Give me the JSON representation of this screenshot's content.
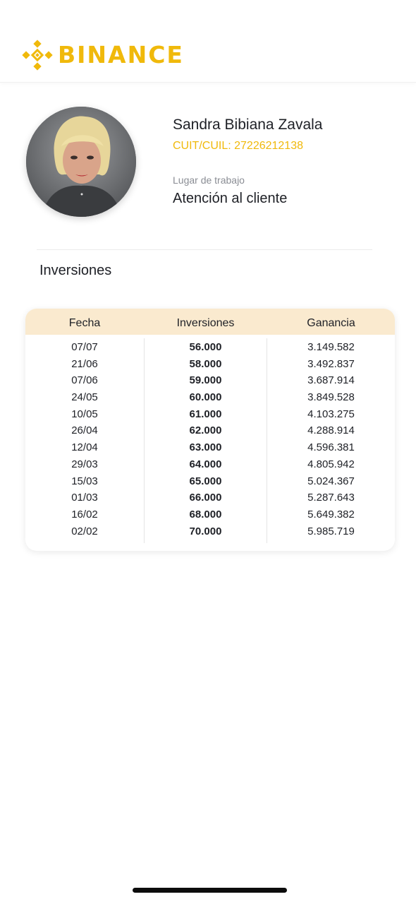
{
  "brand": {
    "name": "BINANCE",
    "color": "#F0B90B",
    "icon": "binance-logo-icon"
  },
  "profile": {
    "name": "Sandra Bibiana Zavala",
    "tax_id": "CUIT/CUIL: 27226212138",
    "work_label": "Lugar de trabajo",
    "work_value": "Atención al cliente"
  },
  "investments": {
    "title": "Inversiones",
    "headers": [
      "Fecha",
      "Inversiones",
      "Ganancia"
    ],
    "rows": [
      {
        "fecha": "07/07",
        "inversion": "56.000",
        "ganancia": "3.149.582"
      },
      {
        "fecha": "21/06",
        "inversion": "58.000",
        "ganancia": "3.492.837"
      },
      {
        "fecha": "07/06",
        "inversion": "59.000",
        "ganancia": "3.687.914"
      },
      {
        "fecha": "24/05",
        "inversion": "60.000",
        "ganancia": "3.849.528"
      },
      {
        "fecha": "10/05",
        "inversion": "61.000",
        "ganancia": "4.103.275"
      },
      {
        "fecha": "26/04",
        "inversion": "62.000",
        "ganancia": "4.288.914"
      },
      {
        "fecha": "12/04",
        "inversion": "63.000",
        "ganancia": "4.596.381"
      },
      {
        "fecha": "29/03",
        "inversion": "64.000",
        "ganancia": "4.805.942"
      },
      {
        "fecha": "15/03",
        "inversion": "65.000",
        "ganancia": "5.024.367"
      },
      {
        "fecha": "01/03",
        "inversion": "66.000",
        "ganancia": "5.287.643"
      },
      {
        "fecha": "16/02",
        "inversion": "68.000",
        "ganancia": "5.649.382"
      },
      {
        "fecha": "02/02",
        "inversion": "70.000",
        "ganancia": "5.985.719"
      }
    ]
  },
  "colors": {
    "accent": "#F0B90B",
    "table_header_bg": "#FAEACF",
    "text": "#1E2026",
    "muted": "#8A8D94"
  }
}
